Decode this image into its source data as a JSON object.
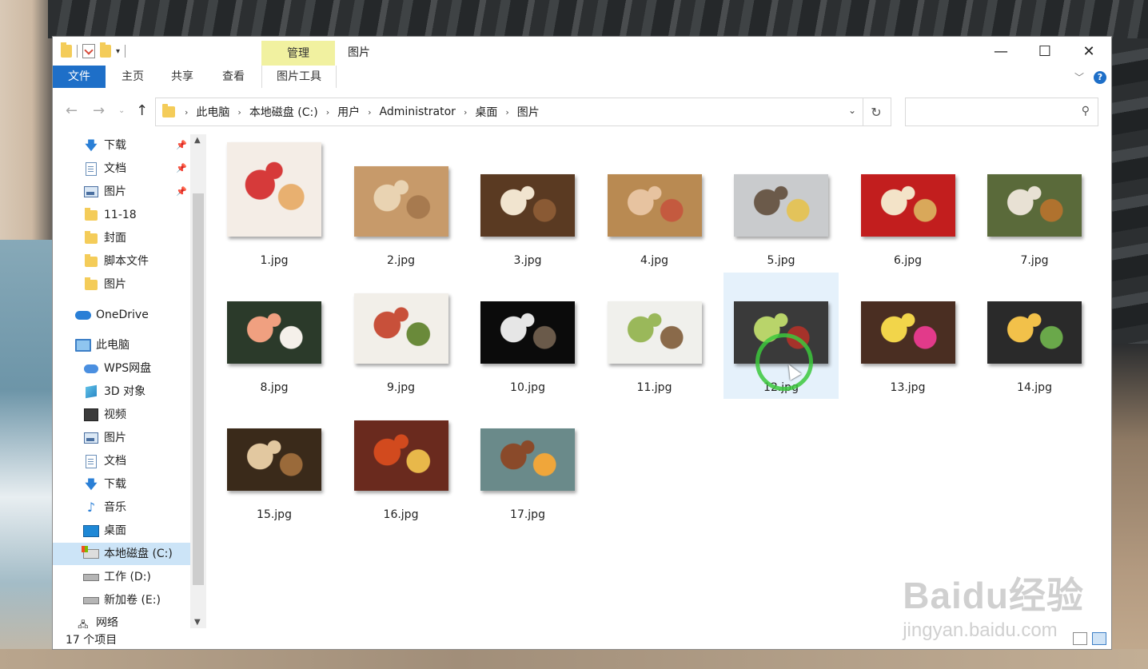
{
  "window": {
    "title": "图片",
    "manage_tab": "管理",
    "controls": {
      "minimize": "—",
      "maximize": "☐",
      "close": "✕"
    }
  },
  "ribbon": {
    "tabs": [
      {
        "label": "文件"
      },
      {
        "label": "主页"
      },
      {
        "label": "共享"
      },
      {
        "label": "查看"
      },
      {
        "label": "图片工具"
      }
    ],
    "help": "?"
  },
  "address": {
    "crumbs": [
      "此电脑",
      "本地磁盘 (C:)",
      "用户",
      "Administrator",
      "桌面",
      "图片"
    ],
    "search_placeholder": ""
  },
  "nav": {
    "quick_access": [
      {
        "label": "下载",
        "icon": "download-arrow-icon",
        "pinned": true
      },
      {
        "label": "文档",
        "icon": "document-icon",
        "pinned": true
      },
      {
        "label": "图片",
        "icon": "pictures-icon",
        "pinned": true
      },
      {
        "label": "11-18",
        "icon": "folder-icon",
        "pinned": false
      },
      {
        "label": "封面",
        "icon": "folder-icon",
        "pinned": false
      },
      {
        "label": "脚本文件",
        "icon": "folder-icon",
        "pinned": false
      },
      {
        "label": "图片",
        "icon": "folder-icon",
        "pinned": false
      }
    ],
    "onedrive": "OneDrive",
    "this_pc": "此电脑",
    "pc_items": [
      {
        "label": "WPS网盘",
        "icon": "wps-cloud-icon"
      },
      {
        "label": "3D 对象",
        "icon": "3d-objects-icon"
      },
      {
        "label": "视频",
        "icon": "video-icon"
      },
      {
        "label": "图片",
        "icon": "pictures-icon"
      },
      {
        "label": "文档",
        "icon": "document-icon"
      },
      {
        "label": "下载",
        "icon": "download-arrow-icon"
      },
      {
        "label": "音乐",
        "icon": "music-icon"
      },
      {
        "label": "桌面",
        "icon": "desktop-icon"
      },
      {
        "label": "本地磁盘 (C:)",
        "icon": "drive-c-icon",
        "selected": true
      },
      {
        "label": "工作 (D:)",
        "icon": "drive-icon"
      },
      {
        "label": "新加卷 (E:)",
        "icon": "drive-icon"
      }
    ],
    "network": "网络"
  },
  "files": [
    {
      "name": "1.jpg",
      "colors": [
        "#f4ede6",
        "#d63a3a",
        "#e8b070"
      ]
    },
    {
      "name": "2.jpg",
      "colors": [
        "#c79a6a",
        "#e9d3b2",
        "#a77a4f"
      ]
    },
    {
      "name": "3.jpg",
      "colors": [
        "#5a3a22",
        "#f1e4cf",
        "#8a5a34"
      ]
    },
    {
      "name": "4.jpg",
      "colors": [
        "#b98a52",
        "#e7c3a0",
        "#c45a3f"
      ]
    },
    {
      "name": "5.jpg",
      "colors": [
        "#c9cbcd",
        "#6b5a4a",
        "#e3c35a"
      ]
    },
    {
      "name": "6.jpg",
      "colors": [
        "#c21e1e",
        "#f3e3c8",
        "#d9a85a"
      ]
    },
    {
      "name": "7.jpg",
      "colors": [
        "#5a6a3a",
        "#e8e1d4",
        "#b0722e"
      ]
    },
    {
      "name": "8.jpg",
      "colors": [
        "#2b3a2a",
        "#f0a080",
        "#f5f0ea"
      ]
    },
    {
      "name": "9.jpg",
      "colors": [
        "#f2efe9",
        "#c8503a",
        "#6a8a3a"
      ]
    },
    {
      "name": "10.jpg",
      "colors": [
        "#0b0b0b",
        "#e6e6e6",
        "#6a5a4a"
      ]
    },
    {
      "name": "11.jpg",
      "colors": [
        "#f0f0ec",
        "#9ab85a",
        "#8a6a4a"
      ]
    },
    {
      "name": "12.jpg",
      "colors": [
        "#3a3a3a",
        "#b9d46a",
        "#a6322a"
      ]
    },
    {
      "name": "13.jpg",
      "colors": [
        "#4a2e22",
        "#f2d54a",
        "#e23a8a"
      ]
    },
    {
      "name": "14.jpg",
      "colors": [
        "#2a2a2a",
        "#f2c14a",
        "#6aa84a"
      ]
    },
    {
      "name": "15.jpg",
      "colors": [
        "#3a2a1a",
        "#e2c8a0",
        "#9a6a3a"
      ]
    },
    {
      "name": "16.jpg",
      "colors": [
        "#6a2a1e",
        "#d24a1e",
        "#e8b84a"
      ]
    },
    {
      "name": "17.jpg",
      "colors": [
        "#6a8a8a",
        "#8a4a2a",
        "#f0a63a"
      ]
    }
  ],
  "selected_file": "12.jpg",
  "status": {
    "count": "17 个项目"
  },
  "watermark": {
    "logo": "Baidu经验",
    "url": "jingyan.baidu.com"
  },
  "colors": {
    "accent": "#1e6fc8",
    "manage_tab": "#f1f1a0",
    "selection": "#e5f1fb"
  }
}
